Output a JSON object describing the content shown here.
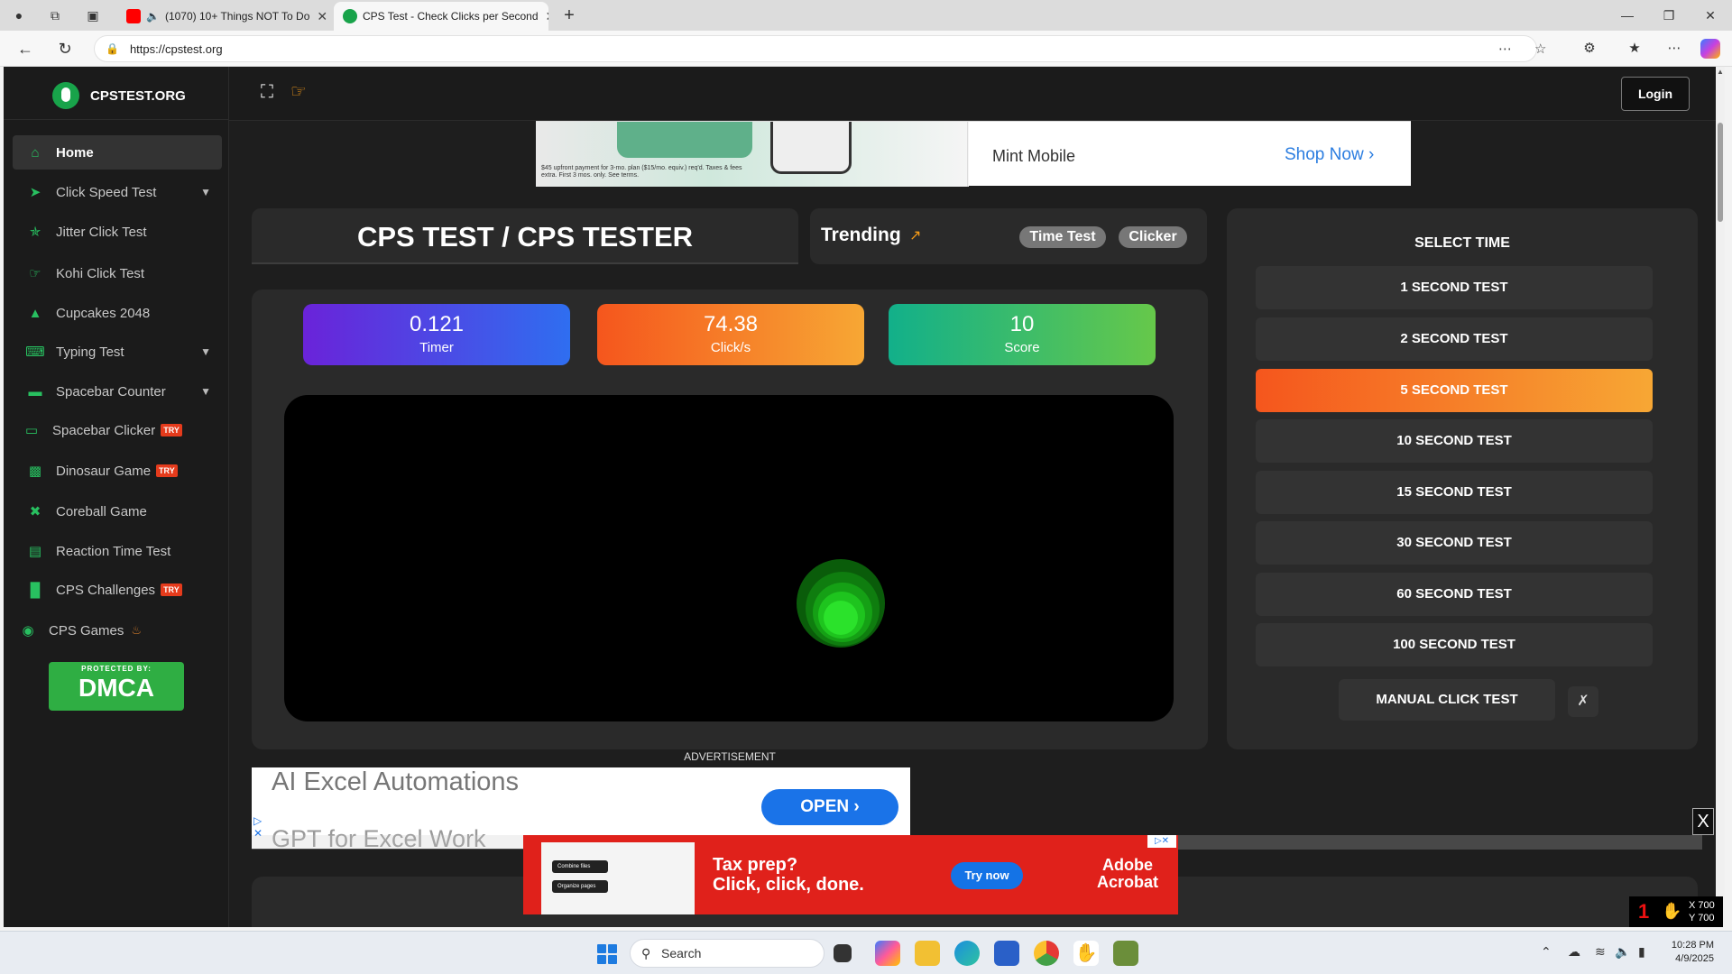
{
  "browser": {
    "tabs": [
      {
        "title": "(1070) 10+ Things NOT To Do",
        "favicon": "youtube-icon",
        "audio": true
      },
      {
        "title": "CPS Test - Check Clicks per Second",
        "favicon": "cpstest-icon",
        "active": true
      }
    ],
    "url": "https://cpstest.org"
  },
  "site": {
    "brand": "CPSTEST.ORG",
    "login": "Login",
    "nav": [
      {
        "label": "Home",
        "icon": "home-icon",
        "active": true
      },
      {
        "label": "Click Speed Test",
        "icon": "cursor-icon",
        "submenu": true
      },
      {
        "label": "Jitter Click Test",
        "icon": "jitter-icon"
      },
      {
        "label": "Kohi Click Test",
        "icon": "hand-click-icon"
      },
      {
        "label": "Cupcakes 2048",
        "icon": "cupcake-icon"
      },
      {
        "label": "Typing Test",
        "icon": "keyboard-icon",
        "submenu": true
      },
      {
        "label": "Spacebar Counter",
        "icon": "spacebar-icon",
        "submenu": true
      },
      {
        "label": "Spacebar Clicker",
        "icon": "spacebar-icon",
        "badge": "TRY"
      },
      {
        "label": "Dinosaur Game",
        "icon": "dinosaur-icon",
        "badge": "TRY"
      },
      {
        "label": "Coreball Game",
        "icon": "coreball-icon"
      },
      {
        "label": "Reaction Time Test",
        "icon": "stopwatch-icon"
      },
      {
        "label": "CPS Challenges",
        "icon": "bar-chart-icon",
        "badge": "TRY"
      },
      {
        "label": "CPS Games",
        "icon": "gamepad-icon"
      }
    ],
    "dmca": {
      "top": "PROTECTED BY:",
      "name": "DMCA"
    }
  },
  "ad_top": {
    "brand": "Mint Mobile",
    "cta": "Shop Now",
    "fine_print": "$45 upfront payment for 3-mo. plan ($15/mo. equiv.) req'd. Taxes & fees extra. First 3 mos. only. See terms."
  },
  "main": {
    "title": "CPS TEST / CPS TESTER",
    "trending": {
      "label": "Trending",
      "pills": [
        "Time Test",
        "Clicker"
      ]
    },
    "stats": {
      "timer": {
        "value": "0.121",
        "label": "Timer"
      },
      "cps": {
        "value": "74.38",
        "label": "Click/s"
      },
      "score": {
        "value": "10",
        "label": "Score"
      }
    }
  },
  "select_time": {
    "heading": "SELECT TIME",
    "options": [
      "1 SECOND TEST",
      "2 SECOND TEST",
      "5 SECOND TEST",
      "10 SECOND TEST",
      "15 SECOND TEST",
      "30 SECOND TEST",
      "60 SECOND TEST",
      "100 SECOND TEST"
    ],
    "selected_index": 2,
    "manual": "MANUAL CLICK TEST"
  },
  "ads": {
    "label": "ADVERTISEMENT",
    "excel": {
      "headline": "AI Excel Automations",
      "sub": "GPT for Excel Work",
      "cta": "OPEN"
    },
    "adobe": {
      "line1": "Tax prep?",
      "line2": "Click, click, done.",
      "cta": "Try now",
      "brand1": "Adobe",
      "brand2": "Acrobat",
      "chip1": "Combine files",
      "chip2": "Organize pages"
    },
    "close": "X"
  },
  "overlay": {
    "count": "1",
    "x": "X 700",
    "y": "Y 700"
  },
  "taskbar": {
    "search": "Search",
    "time": "10:28 PM",
    "date": "4/9/2025"
  },
  "colors": {
    "accent_orange": "#f59b18",
    "brand_green": "#18a34a",
    "page_bg": "#1e1e1e"
  }
}
